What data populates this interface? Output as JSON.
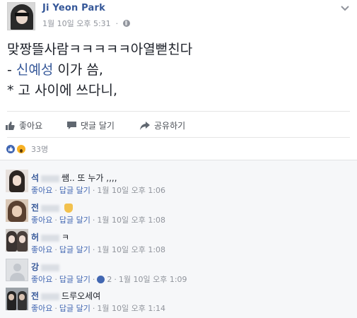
{
  "post": {
    "author": "Ji Yeon Park",
    "timestamp": "1월 10일 오후 5:31",
    "privacy_icon": "globe-icon",
    "menu_icon": "chevron-down-icon",
    "line1": "맞짱뜰사람ㅋㅋㅋㅋㅋ아열뻗친다",
    "line2_prefix": "- ",
    "line2_highlight": "신예성",
    "line2_suffix": " 이가 씀,",
    "line3": "* 고 사이에 쓰다니,"
  },
  "actions": {
    "like": "좋아요",
    "comment": "댓글 달기",
    "share": "공유하기"
  },
  "reactions": {
    "count": "33명",
    "icons": [
      "like-reaction-icon",
      "wow-reaction-icon"
    ]
  },
  "comments": [
    {
      "name": "석",
      "text": "쌤.. 또 누가 ,,,,",
      "like_label": "좋아요",
      "reply_label": "답글 달기",
      "time": "1월 10일 오후 1:06",
      "likes": ""
    },
    {
      "name": "전",
      "text": "",
      "like_label": "좋아요",
      "reply_label": "답글 달기",
      "time": "1월 10일 오후 1:08",
      "likes": ""
    },
    {
      "name": "허",
      "text": "ㅋ",
      "like_label": "좋아요",
      "reply_label": "답글 달기",
      "time": "1월 10일 오후 1:08",
      "likes": ""
    },
    {
      "name": "강",
      "text": "",
      "like_label": "좋아요",
      "reply_label": "답글 달기",
      "time": "1월 10일 오후 1:09",
      "likes": "2"
    },
    {
      "name": "전",
      "text": "드루오세여",
      "like_label": "좋아요",
      "reply_label": "답글 달기",
      "time": "1월 10일 오후 1:14",
      "likes": ""
    }
  ],
  "colors": {
    "link_blue": "#365899",
    "action_blue": "#4267b2",
    "meta_gray": "#90949c",
    "comment_bg": "#f6f7f9"
  }
}
